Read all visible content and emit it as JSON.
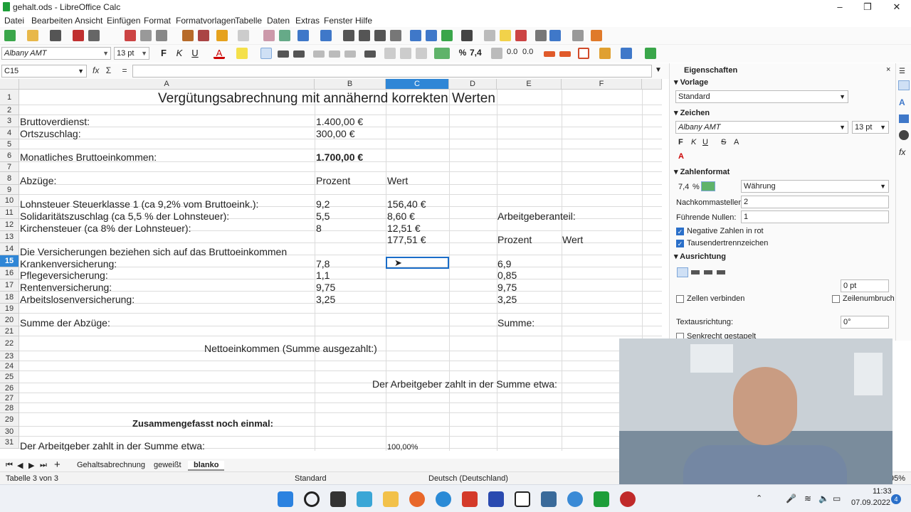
{
  "window": {
    "title": "gehalt.ods - LibreOffice Calc",
    "min": "–",
    "max": "❐",
    "close": "✕"
  },
  "menu": [
    "Datei",
    "Bearbeiten",
    "Ansicht",
    "Einfügen",
    "Format",
    "Formatvorlagen",
    "Tabelle",
    "Daten",
    "Extras",
    "Fenster",
    "Hilfe"
  ],
  "format": {
    "font": "Albany AMT",
    "size": "13 pt"
  },
  "formula": {
    "cellref": "C15",
    "value": "",
    "fx": "fx",
    "sum": "Σ",
    "eq": "="
  },
  "columns": [
    "A",
    "B",
    "C",
    "D",
    "E",
    "F"
  ],
  "rows": [
    "1",
    "2",
    "3",
    "4",
    "5",
    "6",
    "7",
    "8",
    "9",
    "10",
    "11",
    "12",
    "13",
    "14",
    "15",
    "16",
    "17",
    "18",
    "19",
    "20",
    "21",
    "22",
    "23",
    "24",
    "25",
    "26",
    "27",
    "28",
    "29",
    "30",
    "31"
  ],
  "cells": {
    "a1": "Vergütungsabrechnung mit annähernd korrekten Werten",
    "a3": "Bruttoverdienst:",
    "b3": "1.400,00 €",
    "a4": "Ortszuschlag:",
    "b4": "300,00 €",
    "a6": "Monatliches Bruttoeinkommen:",
    "b6": "1.700,00 €",
    "a8": "Abzüge:",
    "b8": "Prozent",
    "c8": "Wert",
    "a10": "Lohnsteuer Steuerklasse 1 (ca 9,2% vom Bruttoeink.):",
    "b10": "9,2",
    "c10": "156,40 €",
    "a11": "Solidaritätszuschlag (ca 5,5 % der Lohnsteuer):",
    "b11": "5,5",
    "c11": "8,60 €",
    "e11": "Arbeitgeberanteil:",
    "a12": "Kirchensteuer (ca 8% der Lohnsteuer):",
    "b12": "8",
    "c12": "12,51 €",
    "c13": "177,51 €",
    "e13": "Prozent",
    "f13": "Wert",
    "a14": "Die Versicherungen beziehen sich auf das Bruttoeinkommen",
    "a15": "Krankenversicherung:",
    "b15": "7,8",
    "e15": "6,9",
    "a16": "Pflegeversicherung:",
    "b16": "1,1",
    "e16": "0,85",
    "a17": "Rentenversicherung:",
    "b17": "9,75",
    "e17": "9,75",
    "a18": "Arbeitslosenversicherung:",
    "b18": "3,25",
    "e18": "3,25",
    "a20": "Summe der Abzüge:",
    "e20": "Summe:",
    "a22": "Nettoeinkommen (Summe ausgezahlt:)",
    "b25": "Der Arbeitgeber zahlt in der Summe etwa:",
    "a29": "Zusammengefasst noch einmal:",
    "a31": "Der Arbeitgeber zahlt in der Summe etwa:",
    "c31": "100,00%"
  },
  "tabs": [
    "Gehaltsabrechnung",
    "geweißt",
    "blanko"
  ],
  "status": {
    "sheet": "Tabelle 3 von 3",
    "style": "Standard",
    "lang": "Deutsch (Deutschland)",
    "zoom": "95%"
  },
  "sidebar": {
    "title": "Eigenschaften",
    "close": "×",
    "vorlage": "Vorlage",
    "vorlage_value": "Standard",
    "zeichen": "Zeichen",
    "font": "Albany AMT",
    "size": "13 pt",
    "zahlenformat": "Zahlenformat",
    "category": "Währung",
    "decimals_label": "Nachkommastellen:",
    "decimals": "2",
    "leading_label": "Führende Nullen:",
    "leading": "1",
    "neg_label": "Negative Zahlen in rot",
    "thousands_label": "Tausendertrennzeichen",
    "ausrichtung": "Ausrichtung",
    "indent": "0 pt",
    "merge_label": "Zellen verbinden",
    "wrap_label": "Zeilenumbruch",
    "textdir_label": "Textausrichtung:",
    "textdir": "0°",
    "stacked_label": "Senkrecht gestapelt",
    "numfmt_74": "7,4",
    "numfmt_pct": "%"
  },
  "clock": {
    "time": "11:33",
    "date": "07.09.2022",
    "badge": "4"
  },
  "colors": {
    "selection": "#2f86d6",
    "calc_green": "#1e9e3a"
  }
}
